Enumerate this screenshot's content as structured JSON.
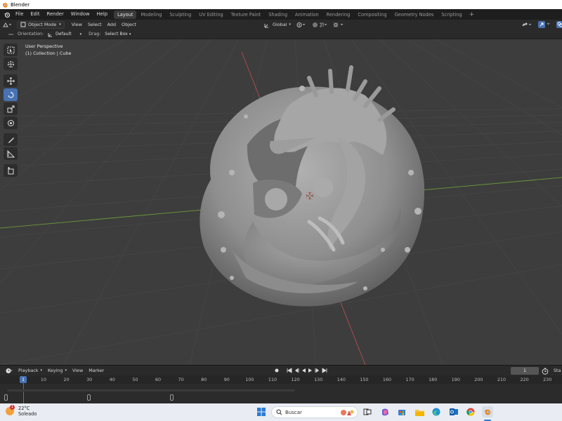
{
  "window": {
    "title": "Blender"
  },
  "menu": {
    "items": [
      "File",
      "Edit",
      "Render",
      "Window",
      "Help"
    ],
    "workspaces": [
      "Layout",
      "Modeling",
      "Sculpting",
      "UV Editing",
      "Texture Paint",
      "Shading",
      "Animation",
      "Rendering",
      "Compositing",
      "Geometry Nodes",
      "Scripting"
    ],
    "active_workspace": "Layout",
    "add_tab": "+"
  },
  "header": {
    "mode": "Object Mode",
    "view": "View",
    "select": "Select",
    "add": "Add",
    "object": "Object",
    "transform_orientation": "Global"
  },
  "tool_settings": {
    "orientation_label": "Orientation:",
    "orientation_value": "Default",
    "drag_label": "Drag:",
    "drag_value": "Select Box"
  },
  "viewport": {
    "perspective": "User Perspective",
    "collection": "(1) Collection | Cube",
    "colors": {
      "background": "#3d3d3d",
      "x_axis": "#b34c55",
      "y_axis": "#6f9a39",
      "mesh": "#9a9a9a",
      "active_tool": "#4772b3"
    }
  },
  "toolbar": {
    "tools": [
      "select-box",
      "cursor",
      "move",
      "rotate",
      "scale",
      "transform",
      "annotate",
      "measure",
      "add-cube"
    ],
    "active_tool": "rotate"
  },
  "timeline": {
    "playback": "Playback",
    "keying": "Keying",
    "view": "View",
    "marker": "Marker",
    "current_frame": "1",
    "frame_input": "1",
    "start_label": "Sta",
    "ruler_ticks": [
      "10",
      "20",
      "30",
      "40",
      "50",
      "60",
      "70",
      "80",
      "90",
      "100",
      "110",
      "120",
      "130",
      "140",
      "150",
      "160",
      "170",
      "180",
      "190",
      "200",
      "210",
      "220",
      "230"
    ]
  },
  "taskbar": {
    "weather_temp": "22°C",
    "weather_status": "Soleado",
    "weather_badge": "1",
    "search_placeholder": "Buscar"
  }
}
